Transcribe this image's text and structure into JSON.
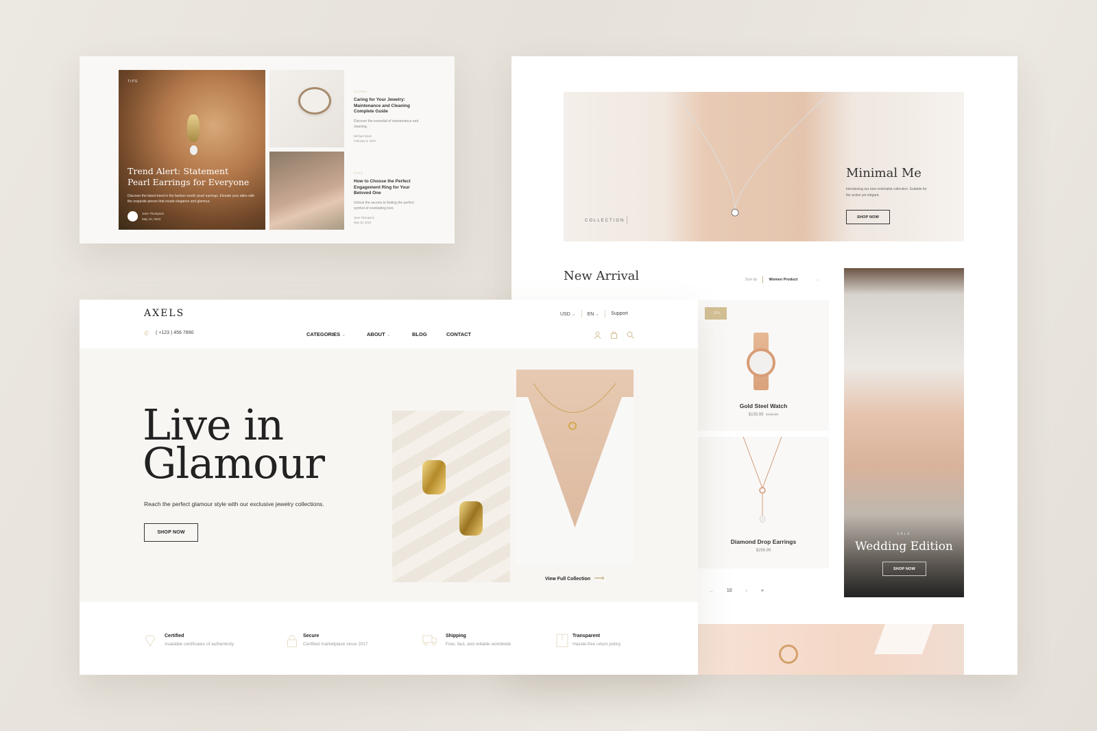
{
  "blog": {
    "featured": {
      "tag": "TIPS",
      "title": "Trend Alert: Statement Pearl Earrings for Everyone",
      "excerpt": "Discover the latest trend in the fashion world: pearl earrings. Elevate your attire with the exquisite pieces that exude elegance and glamour.",
      "author": "Jane Thompson",
      "date": "May 10, 2023"
    },
    "posts": [
      {
        "tag": "GUIDE",
        "title": "Caring for Your Jewelry: Maintenance and Cleaning Complete Guide",
        "excerpt": "Discover the essential of maintenance and cleaning.",
        "author": "Michael Davis",
        "date": "February 5, 2023"
      },
      {
        "tag": "TIPS",
        "title": "How to Choose the Perfect Engagement Ring for Your Beloved One",
        "excerpt": "Unlock the secrets to finding the perfect symbol of everlasting love.",
        "author": "Jane Thompson",
        "date": "May 10, 2023"
      }
    ]
  },
  "collection": {
    "label": "COLLECTION",
    "title": "Minimal Me",
    "description": "Introducing our new minimalist collection. Suitable for the active yet elegant.",
    "cta": "SHOP NOW"
  },
  "new_arrival": {
    "title": "New Arrival",
    "sort_label": "Sort by",
    "sort_value": "Women Product",
    "products": [
      {
        "badge": "- 25%",
        "name": "Gold Steel Watch",
        "price": "$159.99",
        "old_price": "$199.99"
      },
      {
        "name": "Diamond Drop Earrings",
        "price": "$299.99"
      }
    ],
    "pagination": [
      "...",
      "10",
      "›",
      "»"
    ]
  },
  "wedding": {
    "tag": "SALE",
    "title": "Wedding Edition",
    "cta": "SHOP NOW"
  },
  "header": {
    "logo": "AXELS",
    "phone": "( +123 ) 456 7890",
    "currency": "USD",
    "language": "EN",
    "support": "Support",
    "nav": [
      "CATEGORIES",
      "ABOUT",
      "BLOG",
      "CONTACT"
    ]
  },
  "hero": {
    "title_line1": "Live in",
    "title_line2": "Glamour",
    "subtitle": "Reach the perfect glamour style with our exclusive jewelry collections.",
    "cta": "SHOP NOW",
    "view_all": "View Full Collection"
  },
  "features": [
    {
      "icon": "diamond-icon",
      "title": "Certified",
      "desc": "Available certificates of authenticity"
    },
    {
      "icon": "lock-icon",
      "title": "Secure",
      "desc": "Certified marketplace since 2017"
    },
    {
      "icon": "truck-icon",
      "title": "Shipping",
      "desc": "Free, fast, and reliable worldwide"
    },
    {
      "icon": "box-icon",
      "title": "Transparent",
      "desc": "Hassle-free return policy"
    }
  ],
  "colors": {
    "accent": "#c9b48a",
    "hero_bg": "#f8f6f3",
    "text": "#222222"
  }
}
